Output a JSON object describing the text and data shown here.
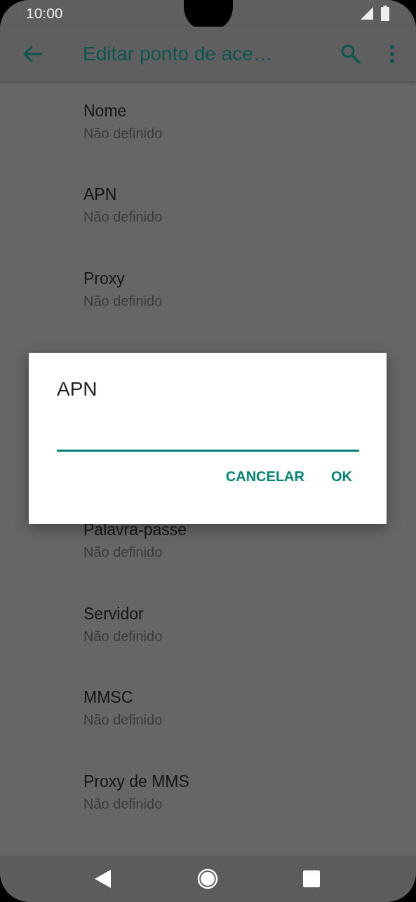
{
  "status_bar": {
    "time": "10:00"
  },
  "app_bar": {
    "title": "Editar ponto de ace…"
  },
  "settings": [
    {
      "title": "Nome",
      "summary": "Não definido"
    },
    {
      "title": "APN",
      "summary": "Não definido"
    },
    {
      "title": "Proxy",
      "summary": "Não definido"
    },
    {
      "title": "Palavra-passe",
      "summary": "Não definido"
    },
    {
      "title": "Servidor",
      "summary": "Não definido"
    },
    {
      "title": "MMSC",
      "summary": "Não definido"
    },
    {
      "title": "Proxy de MMS",
      "summary": "Não definido"
    }
  ],
  "dialog": {
    "title": "APN",
    "buttons": [
      "CANCELAR",
      "OK"
    ]
  }
}
